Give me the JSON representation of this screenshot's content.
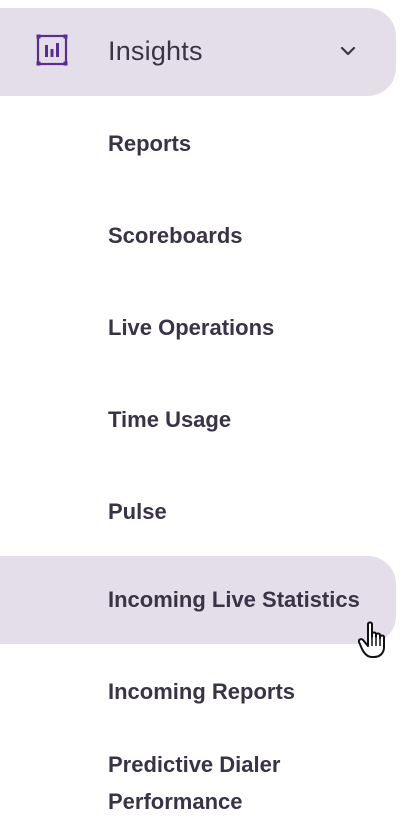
{
  "insights": {
    "title": "Insights",
    "icon": "bar-chart-square-icon",
    "accent_color": "#5b2d8e",
    "highlight_color": "#e4deeb",
    "items": [
      {
        "label": "Reports"
      },
      {
        "label": "Scoreboards"
      },
      {
        "label": "Live Operations"
      },
      {
        "label": "Time Usage"
      },
      {
        "label": "Pulse"
      },
      {
        "label": "Incoming Live Statistics"
      },
      {
        "label": "Incoming Reports"
      },
      {
        "label": "Predictive Dialer Performance"
      }
    ]
  }
}
